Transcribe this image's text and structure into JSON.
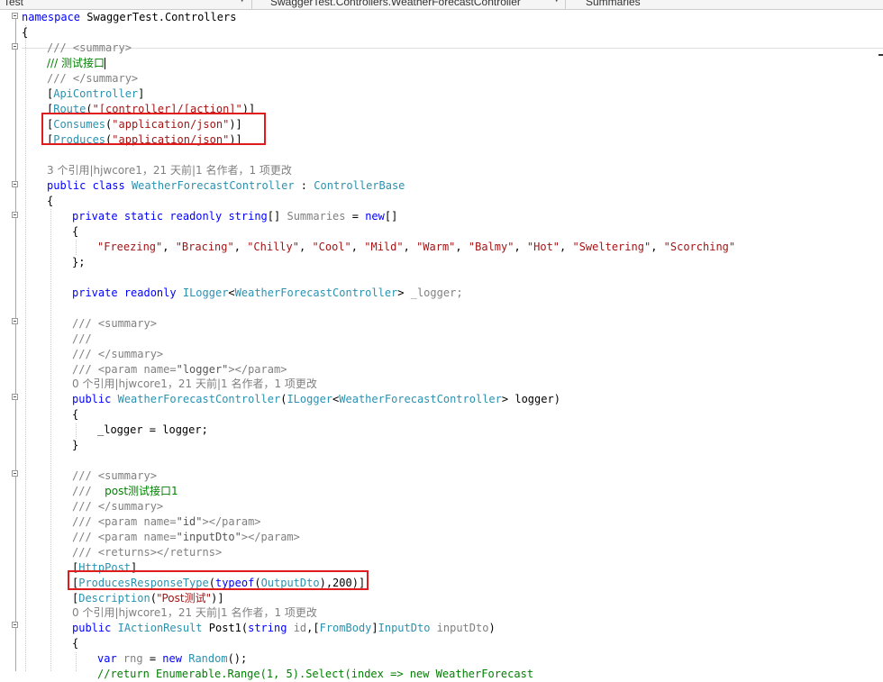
{
  "navbar": {
    "project": "Test",
    "class_path": "SwaggerTest.Controllers.WeatherForecastController",
    "member": "Summaries"
  },
  "code": {
    "ns": {
      "kw": "namespace",
      "name": "SwaggerTest.Controllers"
    },
    "brace_open": "{",
    "brace_close": "}",
    "sum_open": "/// <summary>",
    "sum_text": "/// 测试接口",
    "sum_close": "/// </summary>",
    "attr_api": {
      "a": "[",
      "b": "ApiController",
      "c": "]"
    },
    "attr_route": {
      "a": "[",
      "b": "Route",
      "c": "(",
      "d": "\"[controller]/[action]\"",
      "e": ")]"
    },
    "attr_consumes": {
      "a": "[",
      "b": "Consumes",
      "c": "(",
      "d": "\"application/json\"",
      "e": ")]"
    },
    "attr_produces": {
      "a": "[",
      "b": "Produces",
      "c": "(",
      "d": "\"application/json\"",
      "e": ")]"
    },
    "lens_class": "3 个引用|hjwcore1，21 天前|1 名作者，1 项更改",
    "class_decl": {
      "k1": "public",
      "k2": "class",
      "name": "WeatherForecastController",
      "colon": " : ",
      "base": "ControllerBase"
    },
    "summaries_decl": {
      "k1": "private",
      "k2": "static",
      "k3": "readonly",
      "k4": "string",
      "arr": "[] ",
      "field": "Summaries",
      "eq": " = ",
      "k5": "new",
      "end": "[]"
    },
    "summary_values": [
      "\"Freezing\"",
      "\"Bracing\"",
      "\"Chilly\"",
      "\"Cool\"",
      "\"Mild\"",
      "\"Warm\"",
      "\"Balmy\"",
      "\"Hot\"",
      "\"Sweltering\"",
      "\"Scorching\""
    ],
    "sep": ", ",
    "arr_close": "};",
    "logger_decl": {
      "k1": "private",
      "k2": "readonly",
      "t1": "ILogger",
      "lt": "<",
      "t2": "WeatherForecastController",
      "gt": "> ",
      "field": "_logger",
      "semi": ";"
    },
    "ctor_sum_open": "/// <summary>",
    "ctor_sum_empty": "///",
    "ctor_sum_close": "/// </summary>",
    "ctor_param": {
      "a": "/// <param name=",
      "b": "\"logger\"",
      "c": "></param>"
    },
    "lens_ctor": "0 个引用|hjwcore1，21 天前|1 名作者，1 项更改",
    "ctor_decl": {
      "k1": "public",
      "name": "WeatherForecastController",
      "p": "(",
      "t1": "ILogger",
      "lt": "<",
      "t2": "WeatherForecastController",
      "gt": "> ",
      "arg": "logger)"
    },
    "ctor_body": "_logger = logger;",
    "post_sum_open": "/// <summary>",
    "post_sum_text": {
      "a": "///  ",
      "b": "post测试接口1"
    },
    "post_sum_close": "/// </summary>",
    "post_param_id": {
      "a": "/// <param name=",
      "b": "\"id\"",
      "c": "></param>"
    },
    "post_param_dto": {
      "a": "/// <param name=",
      "b": "\"inputDto\"",
      "c": "></param>"
    },
    "post_returns": "/// <returns></returns>",
    "attr_httppost": {
      "a": "[",
      "b": "HttpPost",
      "c": "]"
    },
    "attr_prt": {
      "a": "[",
      "b": "ProducesResponseType",
      "c": "(",
      "k": "typeof",
      "d": "(",
      "t": "OutputDto",
      "e": "),200)]"
    },
    "attr_desc": {
      "a": "[",
      "b": "Description",
      "c": "(",
      "d": "\"Post测试\"",
      "e": ")]"
    },
    "lens_post": "0 个引用|hjwcore1，21 天前|1 名作者，1 项更改",
    "post_decl": {
      "k1": "public",
      "t1": "IActionResult",
      "name": " Post1(",
      "k2": "string",
      "v1": "id",
      "c": ",[",
      "t2": "FromBody",
      "e": "]",
      "t3": "InputDto",
      "v2": "inputDto",
      ")": ")"
    },
    "rng_line": {
      "k": "var",
      "v": "rng",
      "eq": " = ",
      "k2": "new",
      "t": "Random",
      "end": "();"
    },
    "last_line": "//return Enumerable.Range(1, 5).Select(index => new WeatherForecast"
  }
}
